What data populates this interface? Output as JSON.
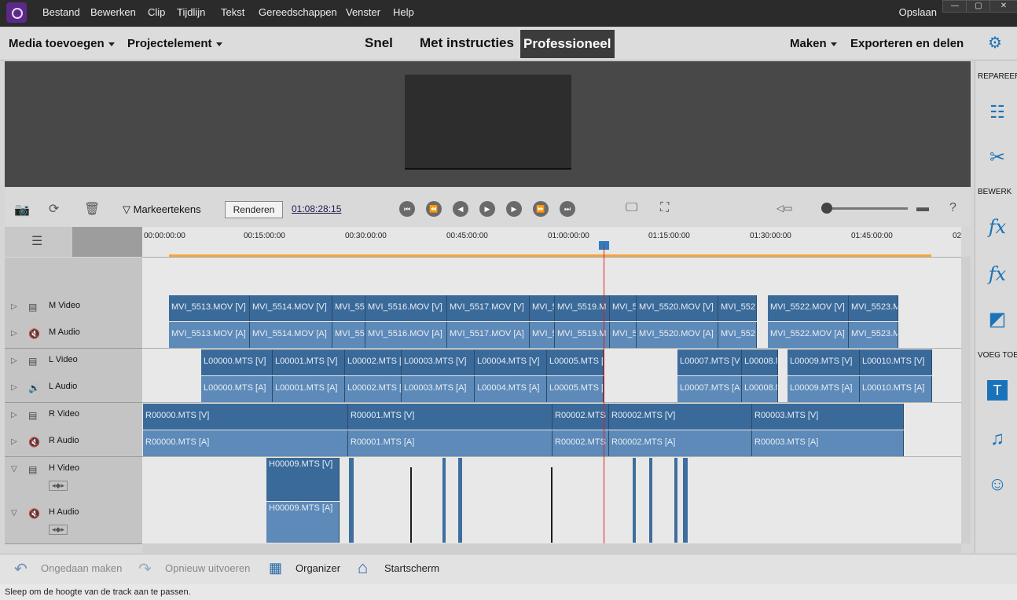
{
  "menu": [
    "Bestand",
    "Bewerken",
    "Clip",
    "Tijdlijn",
    "Tekst",
    "Gereedschappen",
    "Venster",
    "Help"
  ],
  "save_label": "Opslaan",
  "window_buttons": [
    "—",
    "▢",
    "✕"
  ],
  "modebar": {
    "add_media": "Media toevoegen",
    "project_element": "Projectelement",
    "modes": [
      "Snel",
      "Met instructies",
      "Professioneel"
    ],
    "active_mode": "Professioneel",
    "make": "Maken",
    "export": "Exporteren en delen"
  },
  "right_panel": {
    "sections": [
      "REPAREER",
      "BEWERK",
      "VOEG TOE"
    ],
    "icons": [
      "adjust-icon",
      "tools-icon",
      "fx-edit-icon",
      "fx-icon",
      "transition-icon",
      "title-icon",
      "music-icon",
      "graphics-icon"
    ]
  },
  "toolbar": {
    "markers": "Markeertekens",
    "render": "Renderen",
    "timecode": "01:08:28:15"
  },
  "ruler": {
    "labels": [
      "00:00:00:00",
      "00:15:00:00",
      "00:30:00:00",
      "00:45:00:00",
      "01:00:00:00",
      "01:15:00:00",
      "01:30:00:00",
      "01:45:00:00",
      "02"
    ]
  },
  "tracks": [
    {
      "name": "M Video",
      "clips": [
        "MVI_5513.MOV [V]",
        "MVI_5514.MOV [V]",
        "MVI_55",
        "MVI_5516.MOV [V]",
        "MVI_5517.MOV [V]",
        "MVI_5",
        "MVI_5519.M",
        "MVI_5",
        "MVI_5520.MOV [V]",
        "MVI_552",
        "MVI_5522.MOV [V]",
        "MVI_5523.M"
      ]
    },
    {
      "name": "M Audio",
      "clips": [
        "MVI_5513.MOV [A]",
        "MVI_5514.MOV [A]",
        "MVI_55",
        "MVI_5516.MOV [A]",
        "MVI_5517.MOV [A]",
        "MVI_5",
        "MVI_5519.M",
        "MVI_5",
        "MVI_5520.MOV [A]",
        "MVI_552",
        "MVI_5522.MOV [A]",
        "MVI_5523.M"
      ]
    },
    {
      "name": "L Video",
      "clips": [
        "L00000.MTS [V]",
        "L00001.MTS [V]",
        "L00002.MTS [",
        "L00003.MTS [V]",
        "L00004.MTS [V]",
        "L00005.MTS [",
        "L00007.MTS [V",
        "L00008.M",
        "L00009.MTS [V]",
        "L00010.MTS [V]"
      ]
    },
    {
      "name": "L Audio",
      "clips": [
        "L00000.MTS [A]",
        "L00001.MTS [A]",
        "L00002.MTS [",
        "L00003.MTS [A]",
        "L00004.MTS [A]",
        "L00005.MTS [",
        "L00007.MTS [A",
        "L00008.M",
        "L00009.MTS [A]",
        "L00010.MTS [A]"
      ]
    },
    {
      "name": "R Video",
      "clips": [
        "R00000.MTS [V]",
        "R00001.MTS [V]",
        "R00002.MTS [",
        "R00002.MTS [V]",
        "R00003.MTS [V]"
      ]
    },
    {
      "name": "R Audio",
      "clips": [
        "R00000.MTS [A]",
        "R00001.MTS [A]",
        "R00002.MTS [",
        "R00002.MTS [A]",
        "R00003.MTS [A]"
      ]
    },
    {
      "name": "H Video",
      "clips": [
        "H00009.MTS [V]"
      ]
    },
    {
      "name": "H Audio",
      "clips": [
        "H00009.MTS [A]"
      ]
    }
  ],
  "bottom": {
    "undo": "Ongedaan maken",
    "redo": "Opnieuw uitvoeren",
    "organizer": "Organizer",
    "home": "Startscherm"
  },
  "status": "Sleep om de hoogte van de track aan te passen."
}
